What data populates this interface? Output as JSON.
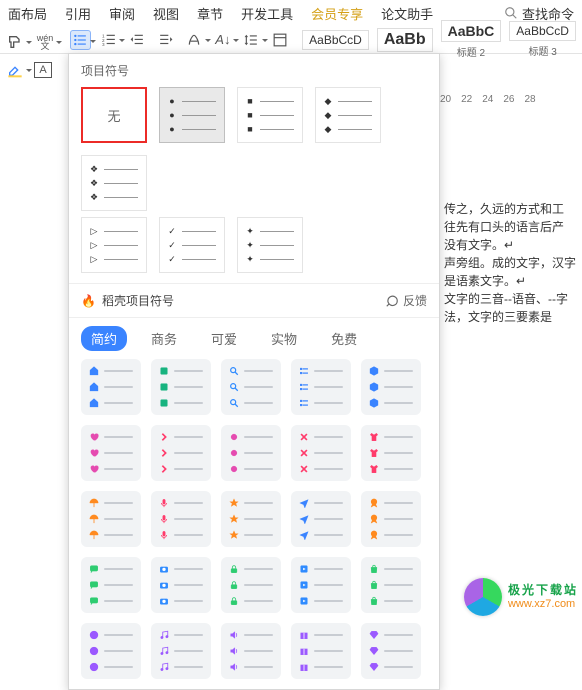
{
  "menubar": {
    "items": [
      "面布局",
      "引用",
      "审阅",
      "视图",
      "章节",
      "开发工具",
      "会员专享",
      "论文助手"
    ],
    "search_placeholder": "查找命令"
  },
  "styles": {
    "normal": "AaBbCcD",
    "h1": "AaBb",
    "h2": "AaBbC",
    "h3": "AaBbCcD",
    "caption2": "标题 2",
    "caption3": "标题 3"
  },
  "ruler": [
    "20",
    "22",
    "24",
    "26",
    "28"
  ],
  "panel": {
    "title": "项目符号",
    "none_label": "无",
    "bullets_r1": [
      "●",
      "■",
      "◆",
      "❖"
    ],
    "bullets_r2": [
      "▷",
      "✓",
      "✦"
    ],
    "docer_title": "稻壳项目符号",
    "feedback": "反馈",
    "tabs": [
      "简约",
      "商务",
      "可爱",
      "实物",
      "免费"
    ],
    "themes": [
      {
        "icon": "home",
        "color": "#3a84ff"
      },
      {
        "icon": "square",
        "color": "#17b37f"
      },
      {
        "icon": "search",
        "color": "#2f8bff"
      },
      {
        "icon": "list",
        "color": "#3a84ff"
      },
      {
        "icon": "cube",
        "color": "#3a84ff"
      },
      {
        "icon": "heart",
        "color": "#e54bb0"
      },
      {
        "icon": "chev",
        "color": "#ff3b6b"
      },
      {
        "icon": "dot",
        "color": "#e54bb0"
      },
      {
        "icon": "x",
        "color": "#ff3b6b"
      },
      {
        "icon": "shirt",
        "color": "#ff3b6b"
      },
      {
        "icon": "umbrella",
        "color": "#ff8a1f"
      },
      {
        "icon": "mic",
        "color": "#ff3b6b"
      },
      {
        "icon": "star",
        "color": "#ff8a1f"
      },
      {
        "icon": "plane",
        "color": "#3a84ff"
      },
      {
        "icon": "ribbon",
        "color": "#ff8a1f"
      },
      {
        "icon": "chat",
        "color": "#2ecc71"
      },
      {
        "icon": "camera",
        "color": "#2f8bff"
      },
      {
        "icon": "lock",
        "color": "#2ecc71"
      },
      {
        "icon": "film",
        "color": "#2f8bff"
      },
      {
        "icon": "bag",
        "color": "#2ecc71"
      },
      {
        "icon": "smile",
        "color": "#9b59ff"
      },
      {
        "icon": "music",
        "color": "#9b59ff"
      },
      {
        "icon": "speaker",
        "color": "#9b59ff"
      },
      {
        "icon": "gift",
        "color": "#9b59ff"
      },
      {
        "icon": "diamond",
        "color": "#9b59ff"
      }
    ]
  },
  "doc_lines": [
    "传之，久远的方式和工",
    "往先有口头的语言后产",
    "没有文字。↵",
    "声旁组。成的文字，汉字",
    "是语素文字。↵",
    "文字的三音--语音、--字",
    "",
    "法，文字的三要素是"
  ],
  "watermark": {
    "line1": "极光下载站",
    "line2": "www.xz7.com"
  }
}
